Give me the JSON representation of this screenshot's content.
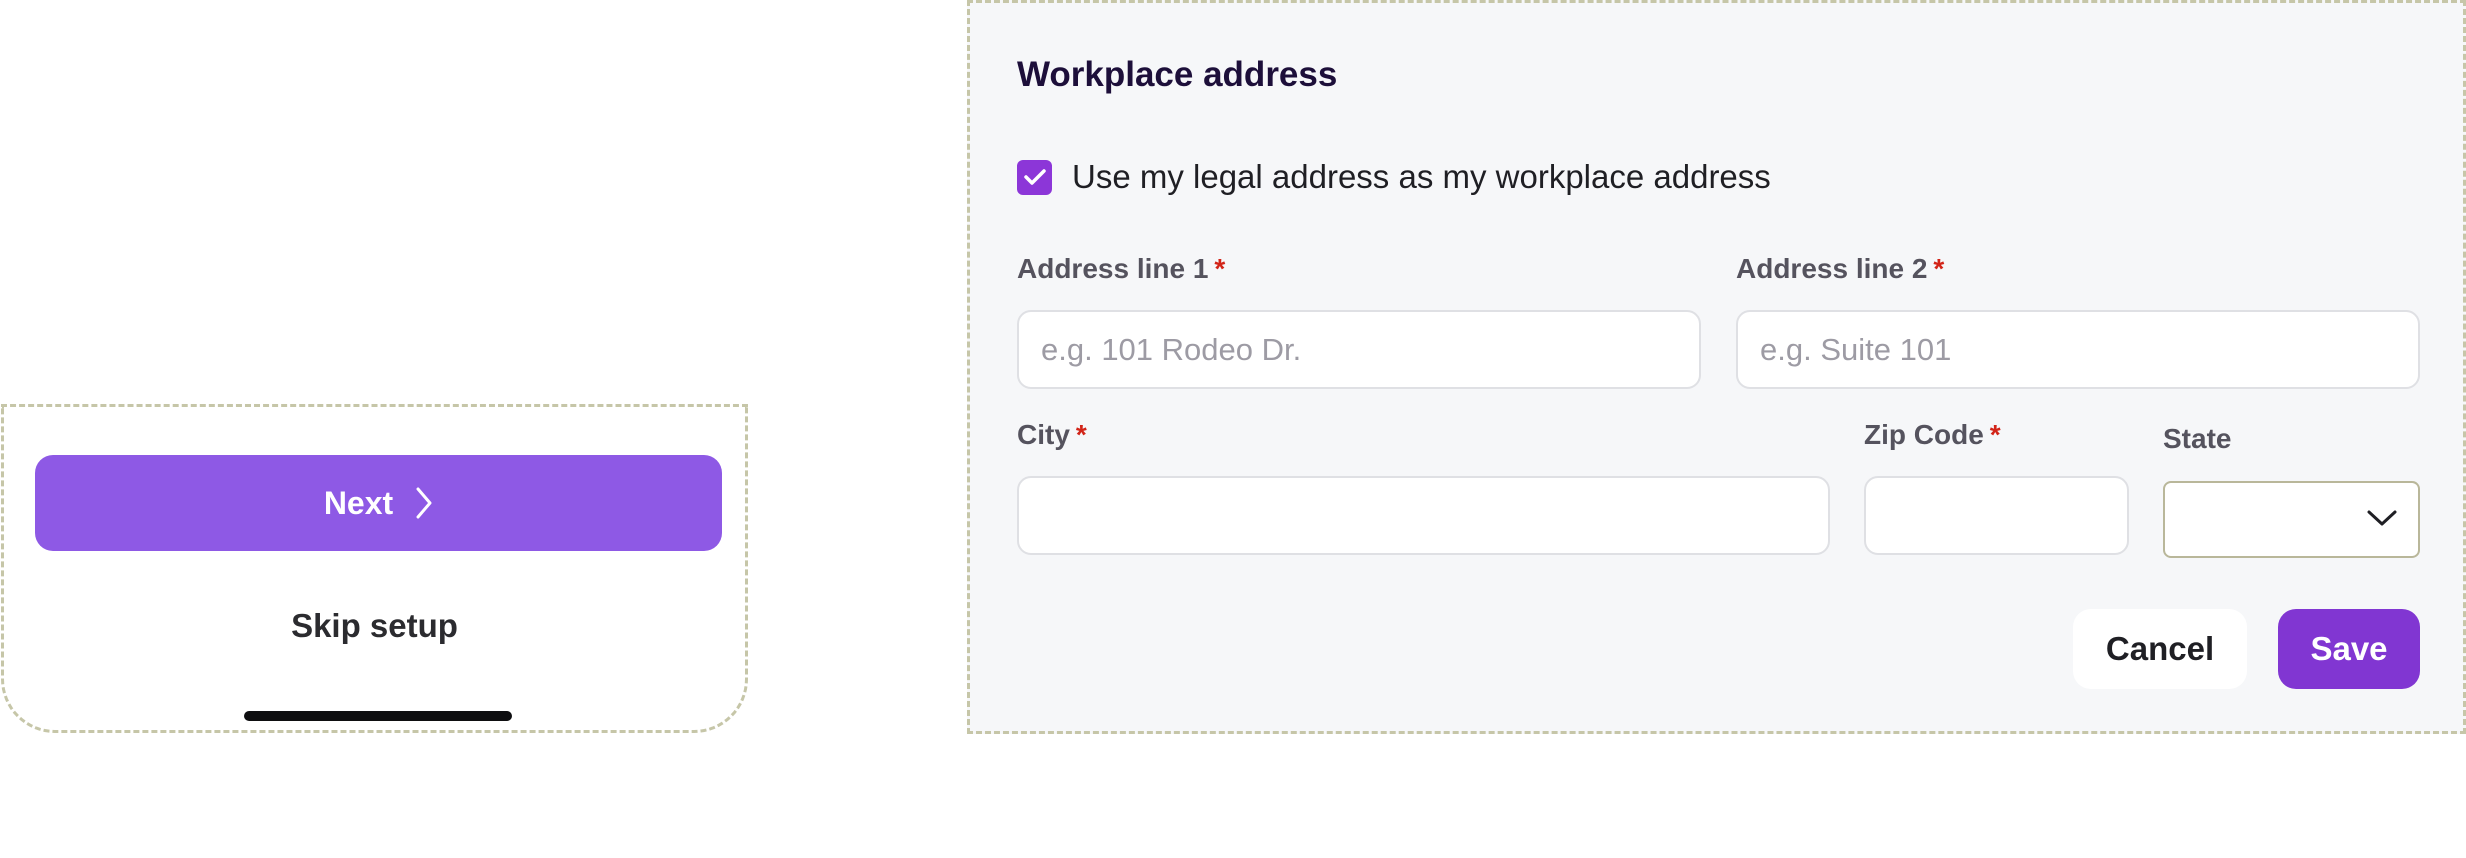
{
  "mobile_footer": {
    "next_label": "Next",
    "skip_label": "Skip setup"
  },
  "form": {
    "title": "Workplace address",
    "use_legal_address": {
      "label": "Use my legal address as my workplace address",
      "checked": true
    },
    "address_line_1": {
      "label": "Address line 1",
      "required_mark": "*",
      "value": "",
      "placeholder": "e.g. 101 Rodeo Dr."
    },
    "address_line_2": {
      "label": "Address line 2",
      "required_mark": "*",
      "value": "",
      "placeholder": "e.g. Suite 101"
    },
    "city": {
      "label": "City",
      "required_mark": "*",
      "value": ""
    },
    "zip_code": {
      "label": "Zip Code",
      "required_mark": "*",
      "value": ""
    },
    "state": {
      "label": "State",
      "selected": ""
    },
    "cancel_label": "Cancel",
    "save_label": "Save"
  },
  "colors": {
    "primary_purple": "#8e59e5",
    "save_purple": "#8136d2",
    "checkbox_purple": "#8c36d8",
    "required_red": "#d22418",
    "panel_background": "#f6f7f9"
  }
}
